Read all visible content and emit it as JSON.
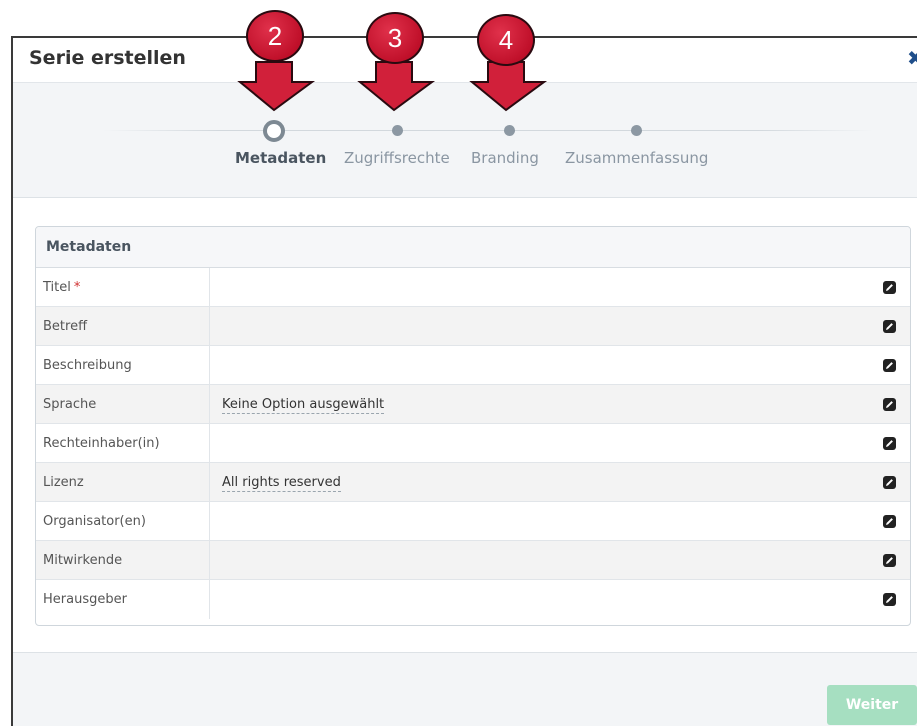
{
  "modal": {
    "title": "Serie erstellen",
    "close_symbol": "✖"
  },
  "wizard": {
    "steps": [
      {
        "label": "Metadaten",
        "active": true
      },
      {
        "label": "Zugriffsrechte",
        "active": false
      },
      {
        "label": "Branding",
        "active": false
      },
      {
        "label": "Zusammenfassung",
        "active": false
      }
    ]
  },
  "metadata": {
    "heading": "Metadaten",
    "rows": [
      {
        "label": "Titel",
        "required": "*",
        "value": ""
      },
      {
        "label": "Betreff",
        "value": ""
      },
      {
        "label": "Beschreibung",
        "value": ""
      },
      {
        "label": "Sprache",
        "value": "Keine Option ausgewählt"
      },
      {
        "label": "Rechteinhaber(in)",
        "value": ""
      },
      {
        "label": "Lizenz",
        "value": "All rights reserved"
      },
      {
        "label": "Organisator(en)",
        "value": ""
      },
      {
        "label": "Mitwirkende",
        "value": ""
      },
      {
        "label": "Herausgeber",
        "value": ""
      }
    ],
    "edit_icon": "pencil-icon"
  },
  "footer": {
    "next_label": "Weiter"
  },
  "annotations": {
    "markers": [
      "2",
      "3",
      "4"
    ]
  },
  "colors": {
    "accent_green": "#a6dfc1",
    "marker_red": "#c0102a",
    "close_blue": "#1f4e8a"
  }
}
